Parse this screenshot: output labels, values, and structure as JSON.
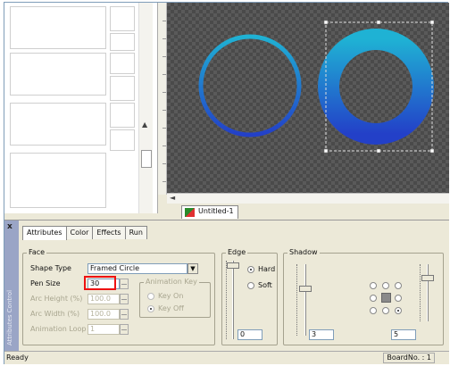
{
  "document_tab": {
    "label": "Untitled-1"
  },
  "tabs": [
    {
      "label": "Attributes",
      "active": true
    },
    {
      "label": "Color",
      "active": false
    },
    {
      "label": "Effects",
      "active": false
    },
    {
      "label": "Run",
      "active": false
    }
  ],
  "panel": {
    "close_glyph": "x",
    "side_label": "Attributes Control"
  },
  "face": {
    "title": "Face",
    "shape_type_label": "Shape Type",
    "shape_type_value": "Framed Circle",
    "pen_size_label": "Pen Size",
    "pen_size_value": "30",
    "arc_height_label": "Arc Height (%)",
    "arc_height_value": "100.0",
    "arc_width_label": "Arc Width (%)",
    "arc_width_value": "100.0",
    "animation_loop_label": "Animation Loop",
    "animation_loop_value": "1",
    "animation_key_title": "Animation Key",
    "key_on_label": "Key On",
    "key_off_label": "Key Off"
  },
  "edge": {
    "title": "Edge",
    "hard_label": "Hard",
    "soft_label": "Soft",
    "selected": "Hard",
    "value": "0"
  },
  "shadow": {
    "title": "Shadow",
    "depth_value": "3",
    "blur_value": "5"
  },
  "status": {
    "left": "Ready",
    "right": "BoardNo. : 1"
  },
  "colors": {
    "ring_top": "#1fb2d4",
    "ring_bottom": "#2340c8",
    "highlight": "#e11111"
  }
}
